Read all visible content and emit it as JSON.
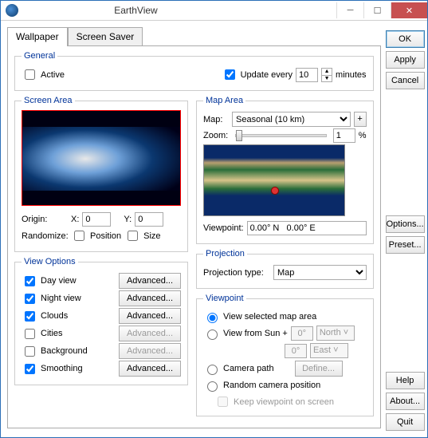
{
  "title": "EarthView",
  "tabs": {
    "wallpaper": "Wallpaper",
    "screensaver": "Screen Saver"
  },
  "buttons": {
    "ok": "OK",
    "apply": "Apply",
    "cancel": "Cancel",
    "options": "Options...",
    "preset": "Preset...",
    "help": "Help",
    "about": "About...",
    "quit": "Quit"
  },
  "general": {
    "legend": "General",
    "active": "Active",
    "update_every": "Update every",
    "update_value": "10",
    "minutes": "minutes"
  },
  "screen_area": {
    "legend": "Screen Area",
    "origin": "Origin:",
    "x_label": "X:",
    "x_val": "0",
    "y_label": "Y:",
    "y_val": "0",
    "randomize": "Randomize:",
    "position": "Position",
    "size": "Size"
  },
  "map_area": {
    "legend": "Map Area",
    "map_label": "Map:",
    "map_sel": "Seasonal (10 km)",
    "zoom_label": "Zoom:",
    "zoom_val": "1",
    "zoom_pct": "%",
    "viewpoint_label": "Viewpoint:",
    "viewpoint_val": "0.00° N   0.00° E",
    "plus": "+"
  },
  "projection": {
    "legend": "Projection",
    "type_label": "Projection type:",
    "type_sel": "Map"
  },
  "view_options": {
    "legend": "View Options",
    "items": [
      {
        "label": "Day view",
        "checked": true,
        "adv": true
      },
      {
        "label": "Night view",
        "checked": true,
        "adv": true
      },
      {
        "label": "Clouds",
        "checked": true,
        "adv": true
      },
      {
        "label": "Cities",
        "checked": false,
        "adv": false
      },
      {
        "label": "Background",
        "checked": false,
        "adv": false
      },
      {
        "label": "Smoothing",
        "checked": true,
        "adv": true
      }
    ],
    "advanced": "Advanced..."
  },
  "viewpoint": {
    "legend": "Viewpoint",
    "selected_map": "View selected map area",
    "from_sun": "View from Sun +",
    "deg0": "0°",
    "north": "North",
    "east": "East",
    "camera_path": "Camera path",
    "define": "Define...",
    "random": "Random camera position",
    "keep": "Keep viewpoint on screen"
  }
}
